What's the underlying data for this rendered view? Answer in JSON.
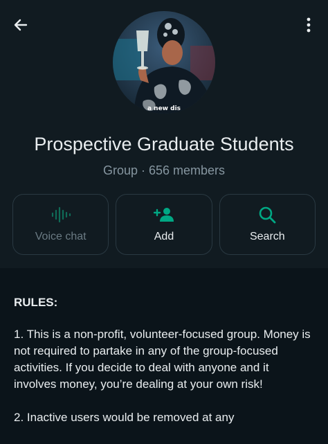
{
  "header": {
    "back_icon": "arrow-left-icon",
    "menu_icon": "more-vertical-icon"
  },
  "profile": {
    "avatar_caption": "a new dis",
    "name": "Prospective Graduate Students",
    "subtitle": "Group · 656 members"
  },
  "actions": [
    {
      "label": "Voice chat",
      "icon": "voice-chat-icon",
      "enabled": false
    },
    {
      "label": "Add",
      "icon": "add-person-icon",
      "enabled": true
    },
    {
      "label": "Search",
      "icon": "search-icon",
      "enabled": true
    }
  ],
  "description": {
    "heading": "RULES:",
    "rules": [
      "1. This is a non-profit, volunteer-focused group. Money is not required to partake in any of the group-focused activities. If you decide to deal with anyone and it involves money, you’re dealing at your own risk!",
      "2. Inactive users would be removed at any"
    ]
  },
  "colors": {
    "accent": "#00a884",
    "header_bg": "#111b21",
    "page_bg": "#0b141a",
    "muted_text": "#8696a0"
  }
}
